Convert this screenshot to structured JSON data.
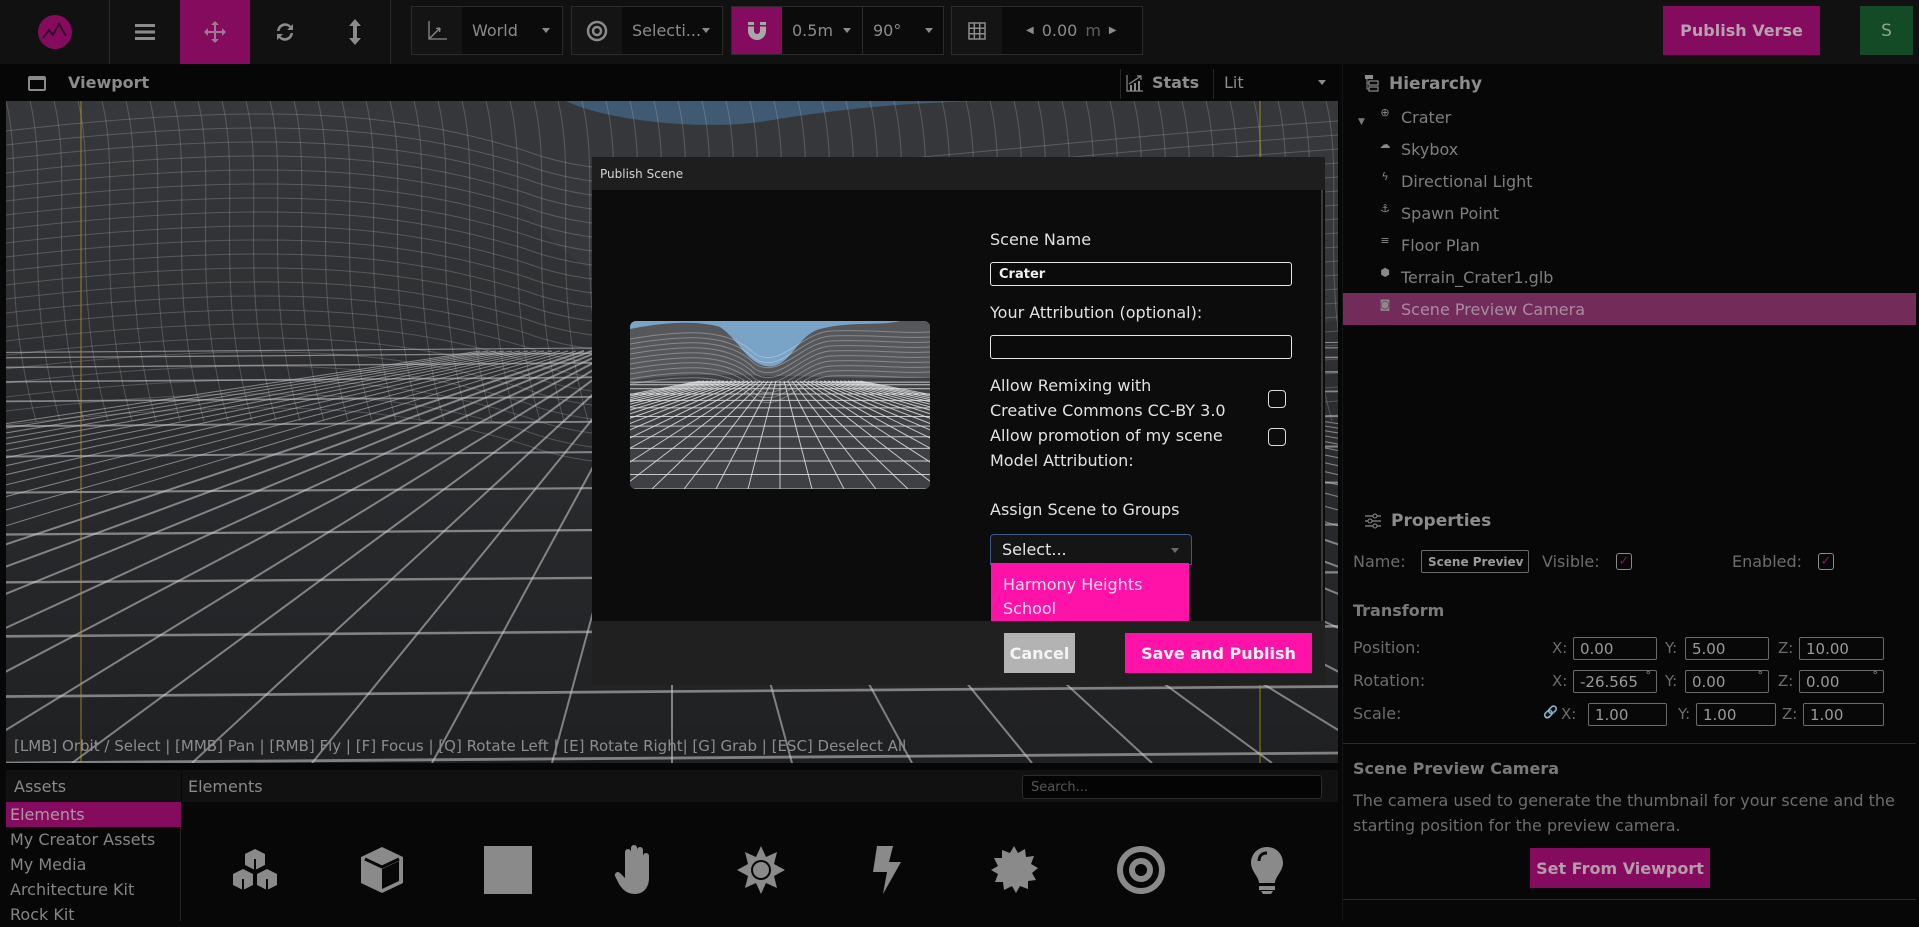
{
  "toolbar": {
    "menu_icon": "hamburger-icon",
    "tools": [
      "translate-icon",
      "rotate-icon",
      "scale-icon"
    ],
    "active_tool": "translate",
    "transform_space": "World",
    "pivot_mode": "Selecti...",
    "snap_translate": "0.5m",
    "snap_rotate": "90°",
    "grid_height": "0.00",
    "grid_unit": "m",
    "publish_label": "Publish Verse",
    "avatar_initial": "S"
  },
  "viewport": {
    "title": "Viewport",
    "stats_label": "Stats",
    "render_mode": "Lit",
    "controls_hint": "[LMB] Orbit / Select | [MMB] Pan | [RMB] Fly | [F] Focus | [Q] Rotate Left | [E] Rotate Right| [G] Grab | [ESC] Deselect All"
  },
  "hierarchy": {
    "title": "Hierarchy",
    "items": [
      {
        "label": "Crater",
        "icon": "globe-icon",
        "selected": false
      },
      {
        "label": "Skybox",
        "icon": "cloud-icon",
        "selected": false
      },
      {
        "label": "Directional Light",
        "icon": "bolt-icon",
        "selected": false
      },
      {
        "label": "Spawn Point",
        "icon": "spawn-icon",
        "selected": false
      },
      {
        "label": "Floor Plan",
        "icon": "floorplan-icon",
        "selected": false
      },
      {
        "label": "Terrain_Crater1.glb",
        "icon": "cube-icon",
        "selected": false
      },
      {
        "label": "Scene Preview Camera",
        "icon": "camera-icon",
        "selected": true
      }
    ]
  },
  "properties": {
    "title": "Properties",
    "name_label": "Name:",
    "name_value": "Scene Previev",
    "visible_label": "Visible:",
    "visible": true,
    "enabled_label": "Enabled:",
    "enabled": true,
    "transform_title": "Transform",
    "position_label": "Position:",
    "rotation_label": "Rotation:",
    "scale_label": "Scale:",
    "position": {
      "x": "0.00",
      "y": "5.00",
      "z": "10.00"
    },
    "rotation": {
      "x": "-26.565",
      "y": "0.00",
      "z": "0.00"
    },
    "scale": {
      "x": "1.00",
      "y": "1.00",
      "z": "1.00"
    },
    "axis_x": "X:",
    "axis_y": "Y:",
    "axis_z": "Z:",
    "degree": "°",
    "component_title": "Scene Preview Camera",
    "component_desc": "The camera used to generate the thumbnail for your scene and the starting position for the preview camera.",
    "set_from_viewport": "Set From Viewport"
  },
  "assets": {
    "title": "Assets",
    "categories": [
      {
        "label": "Elements",
        "active": true
      },
      {
        "label": "My Creator Assets",
        "active": false
      },
      {
        "label": "My Media",
        "active": false
      },
      {
        "label": "Architecture Kit",
        "active": false
      },
      {
        "label": "Rock Kit",
        "active": false
      }
    ],
    "section_title": "Elements",
    "search_placeholder": "Search...",
    "elements": [
      "group-cubes-icon",
      "cube-icon",
      "image-icon",
      "hand-icon",
      "sun-icon",
      "bolt-icon",
      "badge-icon",
      "target-icon",
      "bulb-icon"
    ]
  },
  "dialog": {
    "title": "Publish Scene",
    "scene_name_label": "Scene Name",
    "scene_name_value": "Crater",
    "attribution_label": "Your Attribution (optional):",
    "attribution_value": "",
    "remix_label_line1": "Allow Remixing  with",
    "remix_label_line2": "Creative Commons  CC-BY 3.0",
    "remix_checked": false,
    "promotion_label": "Allow promotion of my scene",
    "promotion_checked": false,
    "model_attribution_label": "Model Attribution:",
    "groups_label": "Assign Scene to Groups",
    "groups_placeholder": "Select...",
    "groups_options": [
      "Harmony Heights School"
    ],
    "cancel_label": "Cancel",
    "save_label": "Save and Publish"
  },
  "colors": {
    "accent": "#850b5e",
    "accent_bright": "#ff12a8",
    "selected_row": "#732b5a",
    "avatar_bg": "#154a26"
  }
}
